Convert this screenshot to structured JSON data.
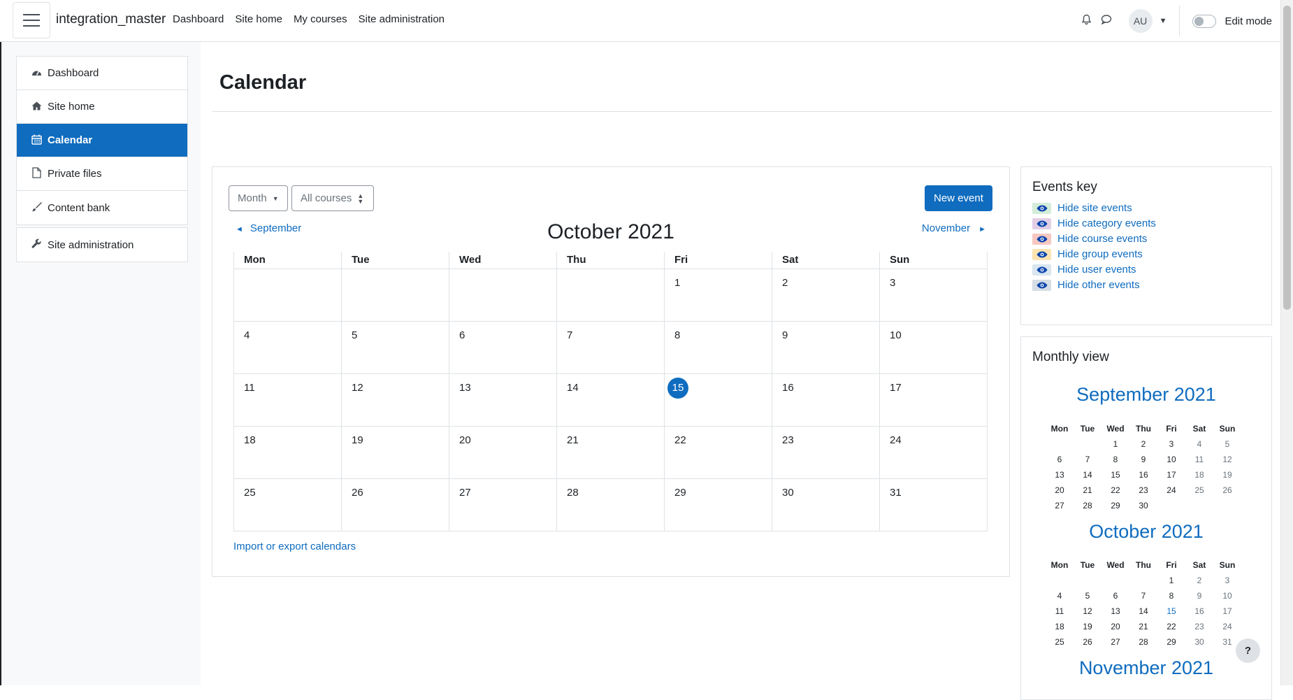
{
  "navbar": {
    "site_name": "integration_master",
    "links": [
      "Dashboard",
      "Site home",
      "My courses",
      "Site administration"
    ],
    "user_initials": "AU",
    "edit_mode_label": "Edit mode"
  },
  "drawer": {
    "items": [
      {
        "label": "Dashboard",
        "icon": "dashboard-icon"
      },
      {
        "label": "Site home",
        "icon": "home-icon"
      },
      {
        "label": "Calendar",
        "icon": "calendar-icon",
        "active": true
      },
      {
        "label": "Private files",
        "icon": "file-icon"
      },
      {
        "label": "Content bank",
        "icon": "paintbrush-icon"
      }
    ],
    "admin_item": {
      "label": "Site administration",
      "icon": "wrench-icon"
    }
  },
  "page": {
    "title": "Calendar"
  },
  "calendar": {
    "view_select": "Month",
    "course_select": "All courses",
    "new_event_label": "New event",
    "prev_month": "September",
    "next_month": "November",
    "month_title": "October 2021",
    "weekdays": [
      "Mon",
      "Tue",
      "Wed",
      "Thu",
      "Fri",
      "Sat",
      "Sun"
    ],
    "weeks": [
      [
        "",
        "",
        "",
        "",
        "1",
        "2",
        "3"
      ],
      [
        "4",
        "5",
        "6",
        "7",
        "8",
        "9",
        "10"
      ],
      [
        "11",
        "12",
        "13",
        "14",
        "15",
        "16",
        "17"
      ],
      [
        "18",
        "19",
        "20",
        "21",
        "22",
        "23",
        "24"
      ],
      [
        "25",
        "26",
        "27",
        "28",
        "29",
        "30",
        "31"
      ]
    ],
    "today": "15",
    "import_link": "Import or export calendars"
  },
  "events_key": {
    "title": "Events key",
    "items": [
      {
        "label": "Hide site events",
        "color": "#d4edda"
      },
      {
        "label": "Hide category events",
        "color": "#e2cfe6"
      },
      {
        "label": "Hide course events",
        "color": "#f6c8c1"
      },
      {
        "label": "Hide group events",
        "color": "#fce3b1"
      },
      {
        "label": "Hide user events",
        "color": "#d9e6f0"
      },
      {
        "label": "Hide other events",
        "color": "#d6dde4"
      }
    ]
  },
  "monthly_view": {
    "title": "Monthly view",
    "weekdays": [
      "Mon",
      "Tue",
      "Wed",
      "Thu",
      "Fri",
      "Sat",
      "Sun"
    ],
    "months": [
      {
        "title": "September 2021",
        "weeks": [
          [
            "",
            "",
            "1",
            "2",
            "3",
            "4",
            "5"
          ],
          [
            "6",
            "7",
            "8",
            "9",
            "10",
            "11",
            "12"
          ],
          [
            "13",
            "14",
            "15",
            "16",
            "17",
            "18",
            "19"
          ],
          [
            "20",
            "21",
            "22",
            "23",
            "24",
            "25",
            "26"
          ],
          [
            "27",
            "28",
            "29",
            "30",
            "",
            "",
            ""
          ]
        ]
      },
      {
        "title": "October 2021",
        "weeks": [
          [
            "",
            "",
            "",
            "",
            "1",
            "2",
            "3"
          ],
          [
            "4",
            "5",
            "6",
            "7",
            "8",
            "9",
            "10"
          ],
          [
            "11",
            "12",
            "13",
            "14",
            "15",
            "16",
            "17"
          ],
          [
            "18",
            "19",
            "20",
            "21",
            "22",
            "23",
            "24"
          ],
          [
            "25",
            "26",
            "27",
            "28",
            "29",
            "30",
            "31"
          ]
        ]
      },
      {
        "title": "November 2021"
      }
    ]
  },
  "help_label": "?"
}
